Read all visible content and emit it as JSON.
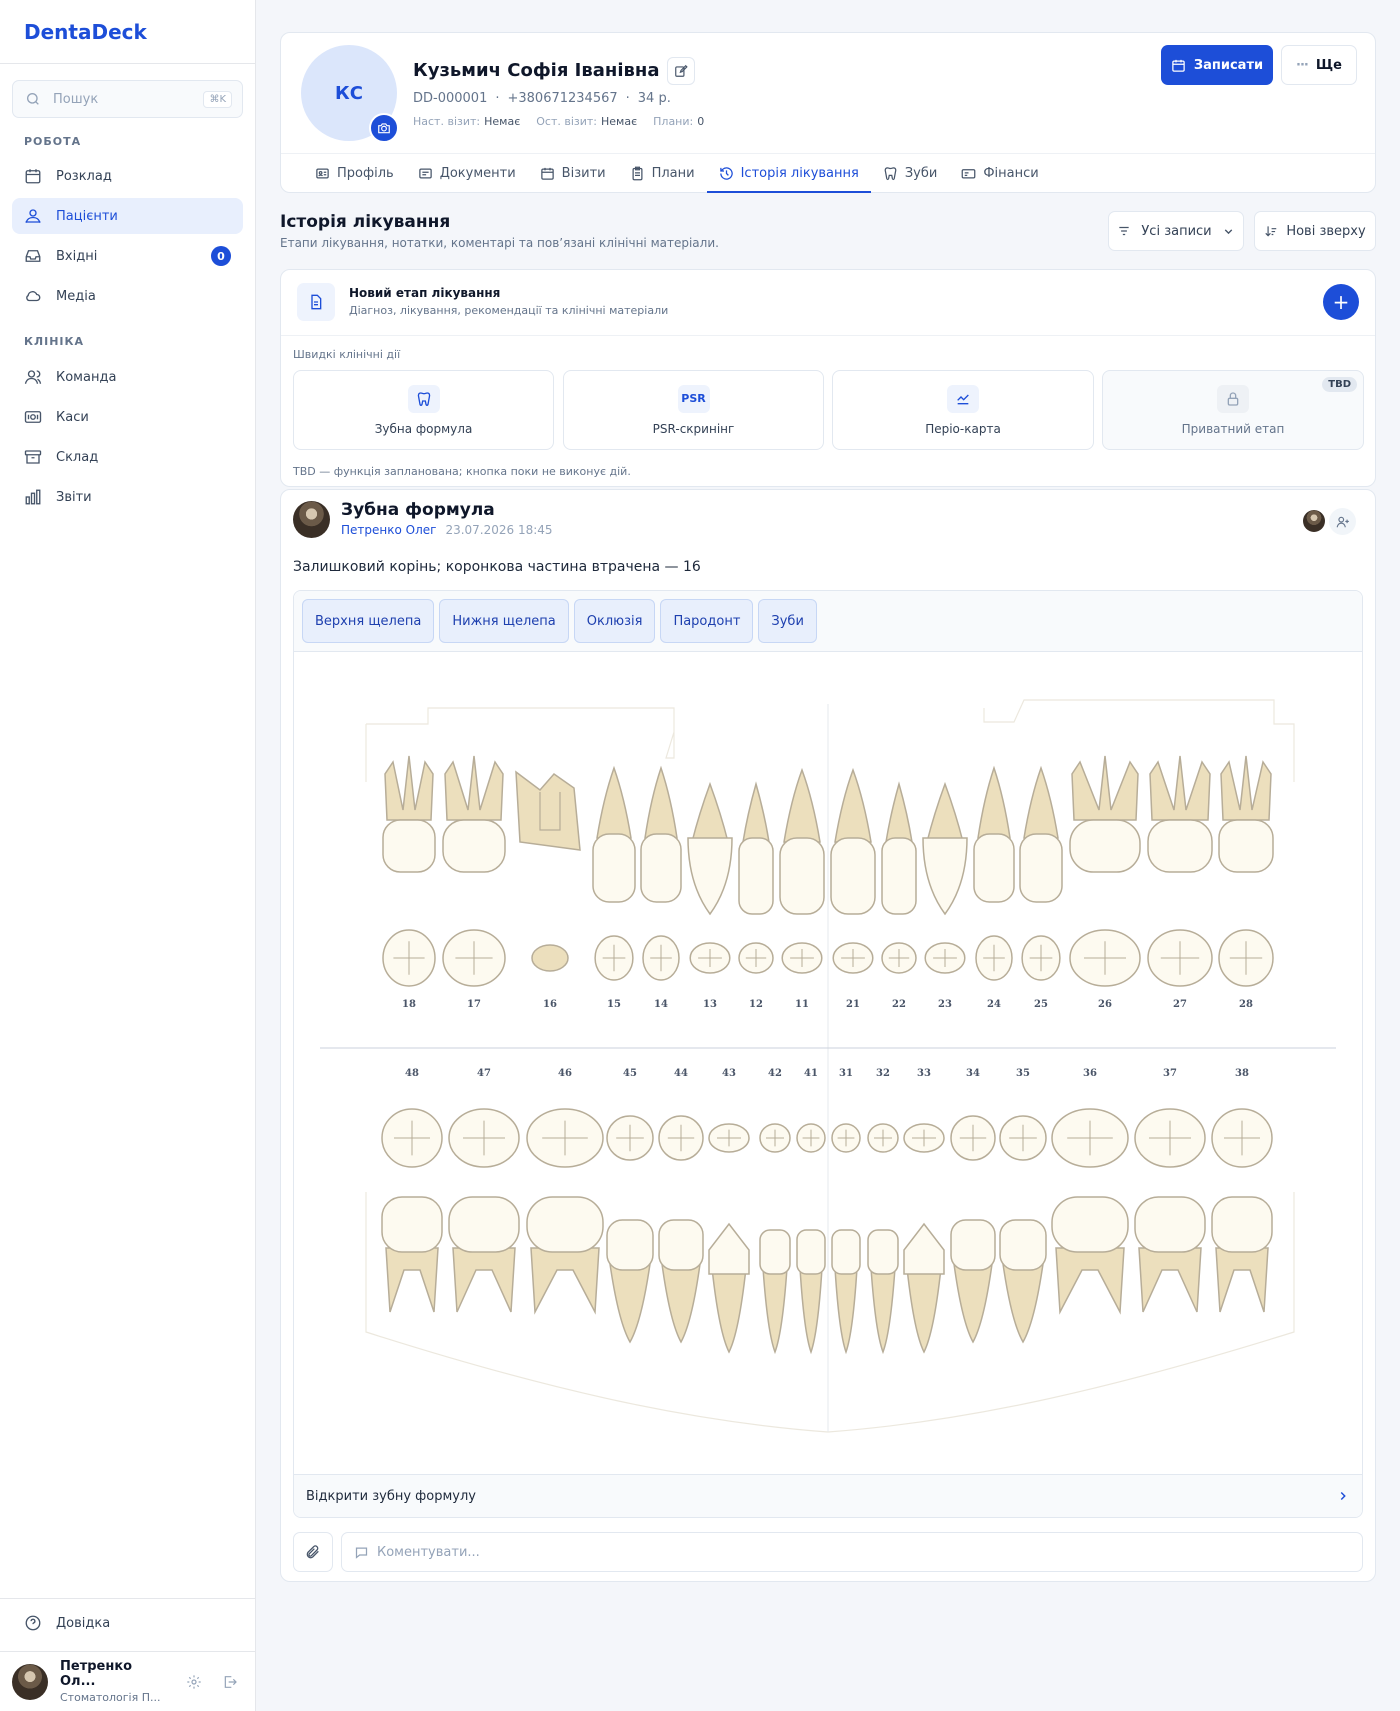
{
  "app": {
    "name": "DentaDeck"
  },
  "sidebar": {
    "search_placeholder": "Пошук",
    "search_kbd": "⌘K",
    "section_work": "РОБОТА",
    "section_clinic": "КЛІНІКА",
    "items": [
      {
        "label": "Розклад",
        "icon": "calendar-icon"
      },
      {
        "label": "Пацієнти",
        "icon": "users-icon",
        "active": true
      },
      {
        "label": "Вхідні",
        "icon": "inbox-icon",
        "badge": "0"
      },
      {
        "label": "Медіа",
        "icon": "cloud-icon"
      },
      {
        "label": "Команда",
        "icon": "team-icon"
      },
      {
        "label": "Каси",
        "icon": "cash-icon"
      },
      {
        "label": "Склад",
        "icon": "archive-icon"
      },
      {
        "label": "Звіти",
        "icon": "chart-icon"
      }
    ],
    "help": "Довідка",
    "user": {
      "name": "Петренко Ол...",
      "clinic": "Стоматологія П..."
    }
  },
  "patient": {
    "initials": "КС",
    "name": "Кузьмич Софія Іванівна",
    "id": "DD-000001",
    "phone": "+380671234567",
    "age": "34 р.",
    "next_visit_label": "Наст. візит:",
    "next_visit": "Немає",
    "last_visit_label": "Ост. візит:",
    "last_visit": "Немає",
    "plans_label": "Плани:",
    "plans": "0",
    "book_button": "Записати",
    "more_button": "Ще"
  },
  "tabs": [
    {
      "label": "Профіль",
      "icon": "profile-icon"
    },
    {
      "label": "Документи",
      "icon": "documents-icon"
    },
    {
      "label": "Візити",
      "icon": "calendar-icon"
    },
    {
      "label": "Плани",
      "icon": "clipboard-icon"
    },
    {
      "label": "Історія лікування",
      "icon": "history-icon",
      "active": true
    },
    {
      "label": "Зуби",
      "icon": "tooth-icon"
    },
    {
      "label": "Фінанси",
      "icon": "finance-icon"
    }
  ],
  "history": {
    "title": "Історія лікування",
    "subtitle": "Етапи лікування, нотатки, коментарі та пов’язані клінічні матеріали.",
    "filter": "Усі записи",
    "sort": "Нові зверху"
  },
  "new_stage": {
    "title": "Новий етап лікування",
    "subtitle": "Діагноз, лікування, рекомендації та клінічні матеріали",
    "quick_label": "Швидкі клінічні дії",
    "actions": [
      {
        "label": "Зубна формула",
        "icon": "tooth-icon"
      },
      {
        "label": "PSR-скринінг",
        "icon": "PSR"
      },
      {
        "label": "Періо-карта",
        "icon": "perio-chart-icon"
      },
      {
        "label": "Приватний етап",
        "icon": "lock-icon",
        "tag": "TBD"
      }
    ],
    "tbd_note": "TBD — функція запланована; кнопка поки не виконує дій."
  },
  "entry": {
    "title": "Зубна формула",
    "author": "Петренко Олег",
    "datetime": "23.07.2026 18:45",
    "text": "Залишковий корінь; коронкова частина втрачена — 16",
    "segments": [
      "Верхня щелепа",
      "Нижня щелепа",
      "Оклюзія",
      "Пародонт",
      "Зуби"
    ],
    "open_link": "Відкрити зубну формулу",
    "comment_placeholder": "Коментувати..."
  },
  "teeth": {
    "upper": [
      "18",
      "17",
      "16",
      "15",
      "14",
      "13",
      "12",
      "11",
      "21",
      "22",
      "23",
      "24",
      "25",
      "26",
      "27",
      "28"
    ],
    "lower": [
      "48",
      "47",
      "46",
      "45",
      "44",
      "43",
      "42",
      "41",
      "31",
      "32",
      "33",
      "34",
      "35",
      "36",
      "37",
      "38"
    ],
    "residual_root": "16"
  }
}
